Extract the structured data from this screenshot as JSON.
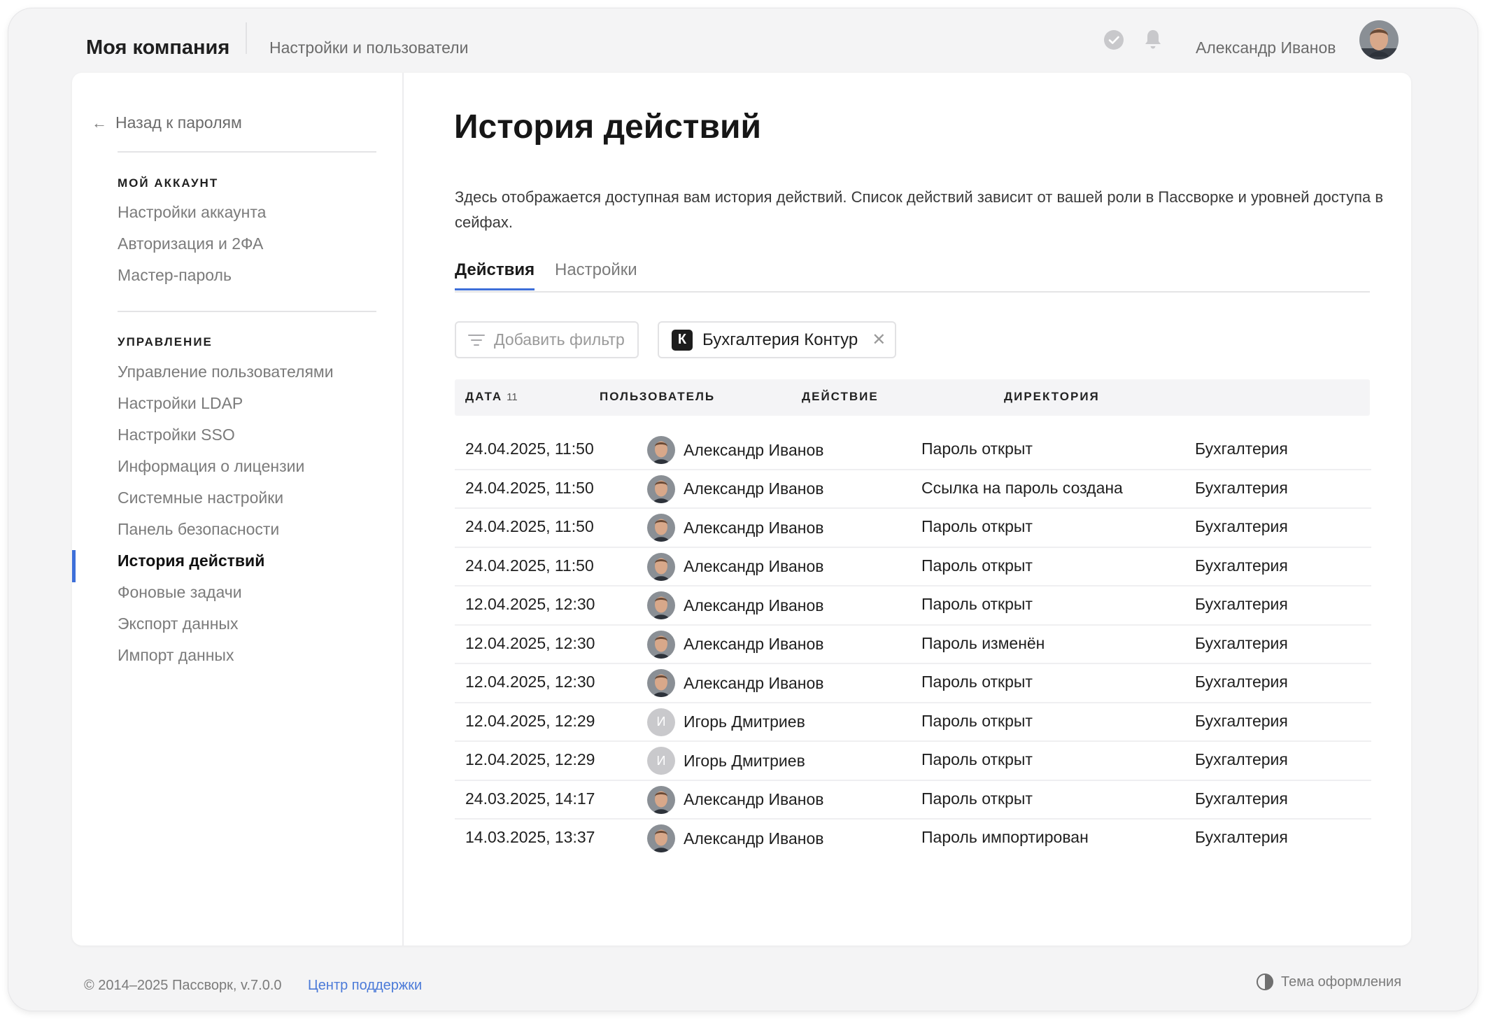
{
  "header": {
    "brand": "Моя компания",
    "section": "Настройки и пользователи",
    "user_name": "Александр Иванов"
  },
  "sidebar": {
    "back_label": "Назад к паролям",
    "account_heading": "МОЙ АККАУНТ",
    "account_items": [
      "Настройки аккаунта",
      "Авторизация и 2ФА",
      "Мастер-пароль"
    ],
    "admin_heading": "УПРАВЛЕНИЕ",
    "admin_items": [
      "Управление пользователями",
      "Настройки LDAP",
      "Настройки SSO",
      "Информация о лицензии",
      "Системные настройки",
      "Панель безопасности",
      "История действий",
      "Фоновые задачи",
      "Экспорт данных",
      "Импорт данных"
    ],
    "active_item": "История действий"
  },
  "main": {
    "title": "История действий",
    "description": "Здесь отображается доступная вам история действий. Список действий зависит от вашей роли в Пассворке и уровней доступа в сейфах.",
    "tabs": [
      "Действия",
      "Настройки"
    ],
    "active_tab": "Действия",
    "add_filter_label": "Добавить фильтр",
    "filter_chip": {
      "logo_letter": "К",
      "label": "Бухгалтерия Контур"
    }
  },
  "table": {
    "columns": {
      "date": "ДАТА",
      "date_count": "11",
      "user": "ПОЛЬЗОВАТЕЛЬ",
      "action": "ДЕЙСТВИЕ",
      "directory": "ДИРЕКТОРИЯ"
    },
    "rows": [
      {
        "date": "24.04.2025, 11:50",
        "user": "Александр Иванов",
        "avatar": "photo",
        "action": "Пароль открыт",
        "directory": "Бухгалтерия"
      },
      {
        "date": "24.04.2025, 11:50",
        "user": "Александр Иванов",
        "avatar": "photo",
        "action": "Ссылка на пароль создана",
        "directory": "Бухгалтерия"
      },
      {
        "date": "24.04.2025, 11:50",
        "user": "Александр Иванов",
        "avatar": "photo",
        "action": "Пароль открыт",
        "directory": "Бухгалтерия"
      },
      {
        "date": "24.04.2025, 11:50",
        "user": "Александр Иванов",
        "avatar": "photo",
        "action": "Пароль открыт",
        "directory": "Бухгалтерия"
      },
      {
        "date": "12.04.2025, 12:30",
        "user": "Александр Иванов",
        "avatar": "photo",
        "action": "Пароль открыт",
        "directory": "Бухгалтерия"
      },
      {
        "date": "12.04.2025, 12:30",
        "user": "Александр Иванов",
        "avatar": "photo",
        "action": "Пароль изменён",
        "directory": "Бухгалтерия"
      },
      {
        "date": "12.04.2025, 12:30",
        "user": "Александр Иванов",
        "avatar": "photo",
        "action": "Пароль открыт",
        "directory": "Бухгалтерия"
      },
      {
        "date": "12.04.2025, 12:29",
        "user": "Игорь Дмитриев",
        "avatar": "И",
        "action": "Пароль открыт",
        "directory": "Бухгалтерия"
      },
      {
        "date": "12.04.2025, 12:29",
        "user": "Игорь Дмитриев",
        "avatar": "И",
        "action": "Пароль открыт",
        "directory": "Бухгалтерия"
      },
      {
        "date": "24.03.2025, 14:17",
        "user": "Александр Иванов",
        "avatar": "photo",
        "action": "Пароль открыт",
        "directory": "Бухгалтерия"
      },
      {
        "date": "14.03.2025, 13:37",
        "user": "Александр Иванов",
        "avatar": "photo",
        "action": "Пароль импортирован",
        "directory": "Бухгалтерия"
      }
    ]
  },
  "footer": {
    "copyright": "© 2014–2025 Пассворк, v.7.0.0",
    "support_link": "Центр поддержки",
    "theme_label": "Тема оформления"
  },
  "colors": {
    "accent": "#3d6fd9",
    "link": "#4b7ad8",
    "muted_text": "#7b7b7b",
    "page_background": "#f4f4f5"
  }
}
